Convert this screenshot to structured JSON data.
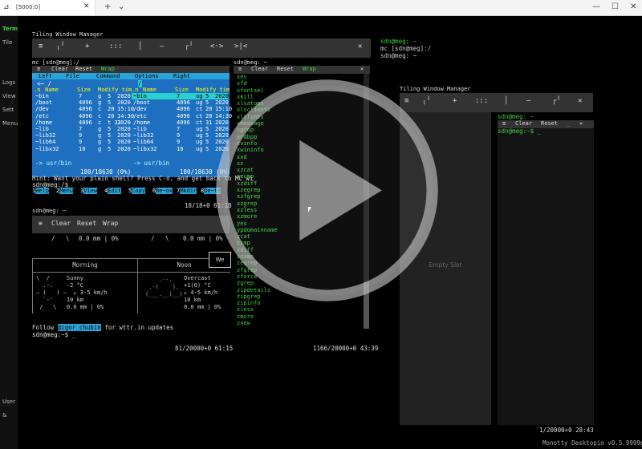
{
  "window": {
    "tab_title": "[5000:0]",
    "new_tab_icon": "plus-icon",
    "tab_dropdown_icon": "chevron-down-icon",
    "minimize_icon": "minimize-icon",
    "maximize_icon": "maximize-icon",
    "close_icon": "close-icon"
  },
  "sidebar": {
    "items": [
      "Term",
      "Tile",
      "Logs",
      "View",
      "Sett",
      "Menu",
      "User",
      "&"
    ]
  },
  "tiler": {
    "title": "Tiling Window Manager",
    "buttons": [
      "≡",
      "╷╵",
      "+",
      ":::",
      "│",
      "—",
      "┌╵",
      "<·>",
      ">|<",
      "✕"
    ]
  },
  "mc": {
    "prompt": "mc [sdn@meg]:/",
    "toolbar": [
      "≡",
      "Clear",
      "Reset",
      "Wrap"
    ],
    "menu": [
      "Left",
      "File",
      "Command",
      "Options",
      "Right"
    ],
    "left_header": "<─ /",
    "right_header": "/",
    "col_headers": [
      ".n",
      "Name",
      "Size",
      "Modify tim"
    ],
    "rows": [
      [
        "~bin",
        "7",
        "g",
        "5",
        "2020"
      ],
      [
        "/boot",
        "4096",
        "g",
        "5",
        "2020"
      ],
      [
        "/dev",
        "4096",
        "c",
        "20",
        "15:10"
      ],
      [
        "/etc",
        "4096",
        "c",
        "20",
        "14:30"
      ],
      [
        "/home",
        "4096",
        "c",
        "t 31",
        "2020"
      ],
      [
        "~lib",
        "7",
        "g",
        "5",
        "2020"
      ],
      [
        "~lib32",
        "9",
        "g",
        "5",
        "2020"
      ],
      [
        "~lib64",
        "9",
        "g",
        "5",
        "2020"
      ],
      [
        "~libx32",
        "10",
        "g",
        "5",
        "2020"
      ]
    ],
    "right_rows": [
      [
        "~bin",
        "7",
        "ug",
        "5",
        "2020"
      ],
      [
        "/boot",
        "4096",
        "ug",
        "5",
        "2020"
      ],
      [
        "/dev",
        "4096",
        "ct",
        "20",
        "15:10"
      ],
      [
        "/etc",
        "4096",
        "ct",
        "20",
        "14:30"
      ],
      [
        "/home",
        "4096",
        "ct",
        "31",
        "2020"
      ],
      [
        "~lib",
        "7",
        "ug",
        "5",
        "2020"
      ],
      [
        "~lib32",
        "9",
        "ug",
        "5",
        "2020"
      ],
      [
        "~lib64",
        "9",
        "ug",
        "5",
        "2020"
      ],
      [
        "~libx32",
        "10",
        "ug",
        "5",
        "2020"
      ]
    ],
    "path": "-> usr/bin",
    "count": "180/18630 (0%)",
    "hint": "Hint: Want your plain shell? Press C-o, and get back to MC wi",
    "shell_prompt": "sdn@meg:/$ _",
    "fkeys": [
      {
        "n": "1",
        "l": "Help"
      },
      {
        "n": "2",
        "l": "Menu"
      },
      {
        "n": "3",
        "l": "View"
      },
      {
        "n": "4",
        "l": "Edit"
      },
      {
        "n": "5",
        "l": "Copy"
      },
      {
        "n": "6",
        "l": "Re~ov"
      },
      {
        "n": "7",
        "l": "Mkdir"
      },
      {
        "n": "8",
        "l": "De~te"
      }
    ],
    "status": "18/18+0 61:18"
  },
  "wttr": {
    "prompt": "sdn@meg: ~",
    "toolbar": [
      "≡",
      "Clear",
      "Reset",
      "Wrap"
    ],
    "top_row": [
      "/   \\",
      "0.0 mm | 0%",
      "/   \\",
      "0.0 mm | 0%"
    ],
    "headers": [
      "Morning",
      "Noon"
    ],
    "morning": [
      "\\  /     Sunny",
      "  .-.    -2 °C",
      "― (   ) ―  ↙ 3-5 km/h",
      "  `-'    10 km",
      " /   \\   0.0 mm | 0%"
    ],
    "noon": [
      "Overcast",
      "+1(0) °C",
      "↙ 4-5 km/h",
      "10 km",
      "0.0 mm | 0%"
    ],
    "follow_prefix": "Follow",
    "follow_handle": "@igor_chubin",
    "follow_suffix": "for wttr.in updates",
    "shell_prompt": "sdn@meg:~$ _",
    "status": "81/20000+0 61:15",
    "we_button": "We"
  },
  "list": {
    "prompt": "sdn@meg: ~",
    "toolbar": [
      "≡",
      "Clear",
      "Reset",
      "Wrap"
    ],
    "items": [
      "xev",
      "xfd",
      "xfontsel",
      "xkill",
      "xlsatoms",
      "xlsclients",
      "xlsfonts",
      "xmessage",
      "xprop",
      "xrdbpp",
      "xvinfo",
      "xwininfo",
      "xxd",
      "xz",
      "xzcat",
      "xzcmp",
      "xzdiff",
      "xzegrep",
      "xzfgrep",
      "xzgrep",
      "xzless",
      "xzmore",
      "yes",
      "ypdomainname",
      "zcat",
      "zcmp",
      "zdiff",
      "zdump",
      "zegrep",
      "zfgrep",
      "zforce",
      "zgrep",
      "zipdetails",
      "zipgrep",
      "zipinfo",
      "zless",
      "zmore",
      "znew"
    ],
    "status": "1166/20000+0 43:39"
  },
  "topright": {
    "prompt": "sdn@meg: ~",
    "lines": [
      "mc [sdn@meg]:/",
      "sdn@meg: ~"
    ]
  },
  "tiler2": {
    "title": "Tiling Window Manager",
    "prompt": "sdn@meg: ~",
    "toolbar": [
      "≡",
      "Clear",
      "Reset",
      "_",
      "✕"
    ],
    "shell_prompt": "sdn@meg:~$ _",
    "empty_slot": "Empty Slot",
    "status": "1/20000+0 28:43"
  },
  "footer": {
    "version": "Monotty Desktopio v0.5.9999g"
  },
  "colors": {
    "mc_blue": "#1e6fc0",
    "green": "#3ed23e",
    "toolbar_gray": "#333333"
  },
  "overlay": {
    "icon": "play-icon"
  }
}
